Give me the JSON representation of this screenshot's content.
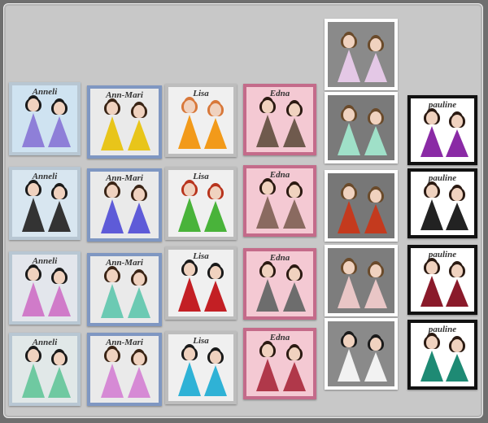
{
  "columns": [
    {
      "id": "anneli",
      "label": "Anneli",
      "items": [
        {
          "bg": "#cfe3f1",
          "border": "#b8c7d3",
          "dress": "#8e7fd8",
          "hair": "#1a1a1a",
          "label": "Anneli"
        },
        {
          "bg": "#d8e6f0",
          "border": "#b8c7d3",
          "dress": "#333333",
          "hair": "#1a1a1a",
          "label": "Anneli"
        },
        {
          "bg": "#e3e6ec",
          "border": "#b8c7d3",
          "dress": "#d07bc9",
          "hair": "#1a1a1a",
          "label": "Anneli"
        },
        {
          "bg": "#e1e8e8",
          "border": "#b8c7d3",
          "dress": "#6fc9a1",
          "hair": "#1a1a1a",
          "label": "Anneli"
        }
      ]
    },
    {
      "id": "ann-mari",
      "label": "Ann-Mari",
      "items": [
        {
          "bg": "#eaeaea",
          "border": "#7f97c2",
          "dress": "#e8c51a",
          "hair": "#3a2415",
          "label": "Ann-Mari"
        },
        {
          "bg": "#eaeaea",
          "border": "#7f97c2",
          "dress": "#5e5bd8",
          "hair": "#3a2415",
          "label": "Ann-Mari"
        },
        {
          "bg": "#eaeaea",
          "border": "#7f97c2",
          "dress": "#6ccab3",
          "hair": "#3a2415",
          "label": "Ann-Mari"
        },
        {
          "bg": "#eaeaea",
          "border": "#7f97c2",
          "dress": "#d68ad5",
          "hair": "#3a2415",
          "label": "Ann-Mari"
        }
      ]
    },
    {
      "id": "lisa",
      "label": "Lisa",
      "items": [
        {
          "bg": "#f0f0f0",
          "border": "#bdbdbd",
          "dress": "#f29a1a",
          "hair": "#d8783a",
          "label": "Lisa"
        },
        {
          "bg": "#f0f0f0",
          "border": "#bdbdbd",
          "dress": "#49b33a",
          "hair": "#b8341d",
          "label": "Lisa"
        },
        {
          "bg": "#f0f0f0",
          "border": "#bdbdbd",
          "dress": "#c31f24",
          "hair": "#1a1a1a",
          "label": "Lisa"
        },
        {
          "bg": "#f0f0f0",
          "border": "#bdbdbd",
          "dress": "#2fb2d6",
          "hair": "#1a1a1a",
          "label": "Lisa"
        }
      ]
    },
    {
      "id": "edna",
      "label": "Edna",
      "items": [
        {
          "bg": "#f4c9d3",
          "border": "#c46b8a",
          "dress": "#6f5a4d",
          "hair": "#2b1a12",
          "label": "Edna"
        },
        {
          "bg": "#f4c9d3",
          "border": "#c46b8a",
          "dress": "#8a6a60",
          "hair": "#2b1a12",
          "label": "Edna"
        },
        {
          "bg": "#f4c9d3",
          "border": "#c46b8a",
          "dress": "#6d6d6d",
          "hair": "#2b1a12",
          "label": "Edna"
        },
        {
          "bg": "#f4c9d3",
          "border": "#c46b8a",
          "dress": "#b0384a",
          "hair": "#2b1a12",
          "label": "Edna"
        }
      ]
    },
    {
      "id": "frida",
      "label": "",
      "items": [
        {
          "bg": "#8a8a8a",
          "border": "#ffffff",
          "dress": "#e4c8e6",
          "hair": "#6a4a2a",
          "label": ""
        },
        {
          "bg": "#7a7a7a",
          "border": "#ffffff",
          "dress": "#9fe0c8",
          "hair": "#6a4a2a",
          "label": ""
        },
        {
          "bg": "#777777",
          "border": "#ffffff",
          "dress": "#c43a1e",
          "hair": "#6a4a2a",
          "label": ""
        },
        {
          "bg": "#7d7d7d",
          "border": "#ffffff",
          "dress": "#e9c6c6",
          "hair": "#6a4a2a",
          "label": ""
        },
        {
          "bg": "#8a8a8a",
          "border": "#ffffff",
          "dress": "#f2f2f2",
          "hair": "#1a1a1a",
          "label": ""
        }
      ]
    },
    {
      "id": "pauline",
      "label": "Pauline",
      "items": [
        {
          "bg": "#ffffff",
          "border": "#111111",
          "dress": "#8a2aa5",
          "hair": "#2b1a12",
          "label": "pauline"
        },
        {
          "bg": "#ffffff",
          "border": "#111111",
          "dress": "#222222",
          "hair": "#2b1a12",
          "label": "pauline"
        },
        {
          "bg": "#ffffff",
          "border": "#111111",
          "dress": "#8a1a2a",
          "hair": "#2b1a12",
          "label": "pauline"
        },
        {
          "bg": "#ffffff",
          "border": "#111111",
          "dress": "#1e8a74",
          "hair": "#2b1a12",
          "label": "pauline"
        }
      ]
    }
  ]
}
